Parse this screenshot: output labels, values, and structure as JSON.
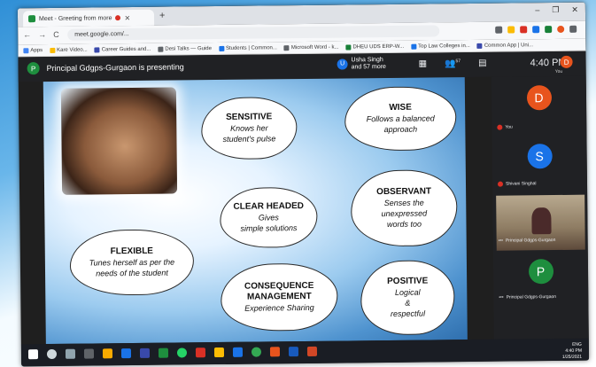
{
  "browser": {
    "tab_title": "Meet - Greeting from more",
    "new_tab": "+",
    "url": "meet.google.com/...",
    "window_controls": [
      "–",
      "❐",
      "✕"
    ],
    "nav_icons": [
      "←",
      "→",
      "C"
    ],
    "bookmarks": [
      {
        "label": "Apps",
        "color": "#4285f4"
      },
      {
        "label": "Kare Video...",
        "color": "#fbbc04"
      },
      {
        "label": "Career Guides and...",
        "color": "#3949ab"
      },
      {
        "label": "Desi Talks — Guide",
        "color": "#5f6368"
      },
      {
        "label": "Students | Common...",
        "color": "#1a73e8"
      },
      {
        "label": "Microsoft Word - k...",
        "color": "#5f6368"
      },
      {
        "label": "DHEU UDS ERP-W...",
        "color": "#188038"
      },
      {
        "label": "Top Law Colleges in...",
        "color": "#1a73e8"
      },
      {
        "label": "Common App | Uni...",
        "color": "#3949ab"
      }
    ]
  },
  "meet": {
    "presenter_initial": "P",
    "presenter_text": "Principal Gdgps-Gurgaon is presenting",
    "people_initial": "U",
    "people_text_1": "Usha Singh",
    "people_text_2": "and 57 more",
    "people_count": "57",
    "clock": "4:40 PM",
    "self_initial": "D",
    "self_label": "You"
  },
  "slide": {
    "clouds": [
      {
        "title": "SENSITIVE",
        "line1": "Knows her",
        "line2": "student's pulse"
      },
      {
        "title": "WISE",
        "line1": "Follows a balanced",
        "line2": "approach"
      },
      {
        "title": "CLEAR HEADED",
        "line1": "Gives",
        "line2": "simple solutions"
      },
      {
        "title": "OBSERVANT",
        "line1": "Senses the",
        "line2": "unexpressed",
        "line3": "words too"
      },
      {
        "title": "FLEXIBLE",
        "line1": "Tunes herself as per the",
        "line2": "needs of the student"
      },
      {
        "title": "CONSEQUENCE",
        "title2": "MANAGEMENT",
        "line1": "Experience Sharing"
      },
      {
        "title": "POSITIVE",
        "line1": "Logical",
        "line2": "&",
        "line3": "respectful"
      }
    ]
  },
  "sidebar": {
    "tiles": [
      {
        "initial": "D",
        "label": "You",
        "color": "#e8541d"
      },
      {
        "initial": "S",
        "label": "Shivani Singhal",
        "color": "#1a73e8"
      },
      {
        "label": "Principal Gdgps-Gurgaon",
        "video": true
      },
      {
        "initial": "P",
        "label": "Principal Gdgps-Gurgaon",
        "color": "#1e8e3e"
      }
    ]
  },
  "taskbar": {
    "time": "4:40 PM",
    "date": "1/25/2021",
    "lang": "ENG"
  }
}
